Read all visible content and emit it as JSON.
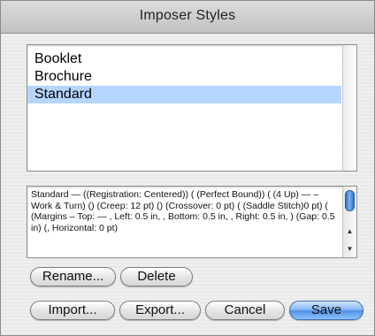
{
  "window": {
    "title": "Imposer Styles"
  },
  "styles_list": {
    "items": [
      {
        "label": "Booklet",
        "selected": false
      },
      {
        "label": "Brochure",
        "selected": false
      },
      {
        "label": "Standard",
        "selected": true
      }
    ]
  },
  "description": {
    "text": "Standard — ((Registration: Centered)) ( (Perfect Bound)) ( (4 Up) —  – Work & Turn) () (Creep: 12 pt) () (Crossover: 0 pt) ( (Saddle Stitch)0 pt) ( (Margins – Top:  —  , Left: 0.5 in, , Bottom: 0.5 in, , Right: 0.5 in, ) (Gap: 0.5 in) (, Horizontal: 0 pt)"
  },
  "buttons": {
    "rename": "Rename...",
    "delete": "Delete",
    "import": "Import...",
    "export": "Export...",
    "cancel": "Cancel",
    "save": "Save"
  },
  "colors": {
    "selection": "#b5d5ff",
    "default_button": "#6fa6ee"
  },
  "icons": {
    "scroll_up": "triangle-up",
    "scroll_down": "triangle-down"
  }
}
